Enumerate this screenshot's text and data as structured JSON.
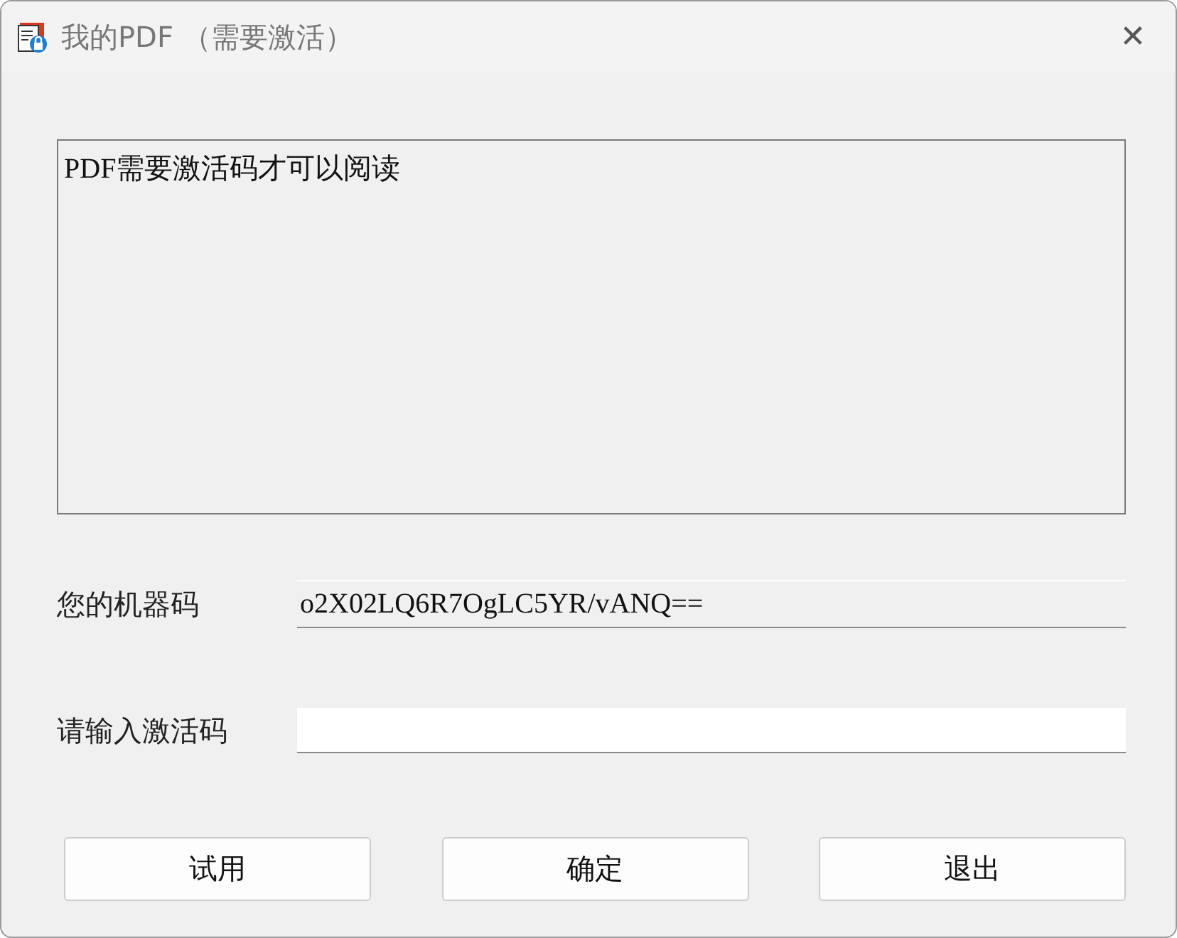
{
  "window": {
    "title": "我的PDF （需要激活）",
    "close": "✕"
  },
  "message": "PDF需要激活码才可以阅读",
  "fields": [
    {
      "kind": "readonly",
      "label": "您的机器码",
      "value": "o2X02LQ6R7OgLC5YR/vANQ=="
    },
    {
      "kind": "input",
      "label": "请输入激活码"
    }
  ],
  "buttons": [
    "试用",
    "确定",
    "退出"
  ]
}
